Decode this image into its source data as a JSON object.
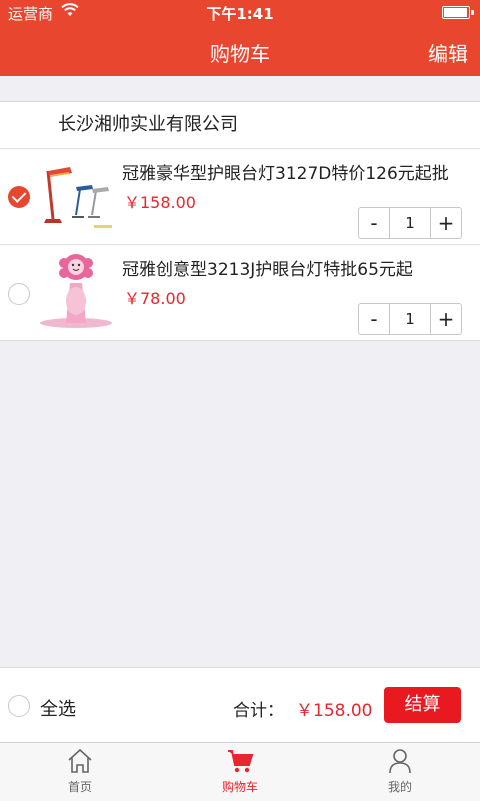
{
  "status": {
    "carrier": "运营商",
    "time": "下午1:41"
  },
  "nav": {
    "title": "购物车",
    "edit": "编辑"
  },
  "shop": {
    "name": "长沙湘帅实业有限公司"
  },
  "items": [
    {
      "name": "冠雅豪华型护眼台灯3127D特价126元起批",
      "price": "￥158.00",
      "qty": "1",
      "checked": true,
      "minus": "-",
      "plus": "+"
    },
    {
      "name": "冠雅创意型3213J护眼台灯特批65元起",
      "price": "￥78.00",
      "qty": "1",
      "checked": false,
      "minus": "-",
      "plus": "+"
    }
  ],
  "footer": {
    "select_all": "全选",
    "total_label": "合计：",
    "total_value": "￥158.00",
    "checkout": "结算"
  },
  "tabs": [
    {
      "label": "首页",
      "icon": "home-icon"
    },
    {
      "label": "购物车",
      "icon": "cart-icon",
      "active": true
    },
    {
      "label": "我的",
      "icon": "user-icon"
    }
  ],
  "colors": {
    "accent": "#e8462f",
    "price": "#e8262f",
    "checkout": "#e8191f"
  }
}
